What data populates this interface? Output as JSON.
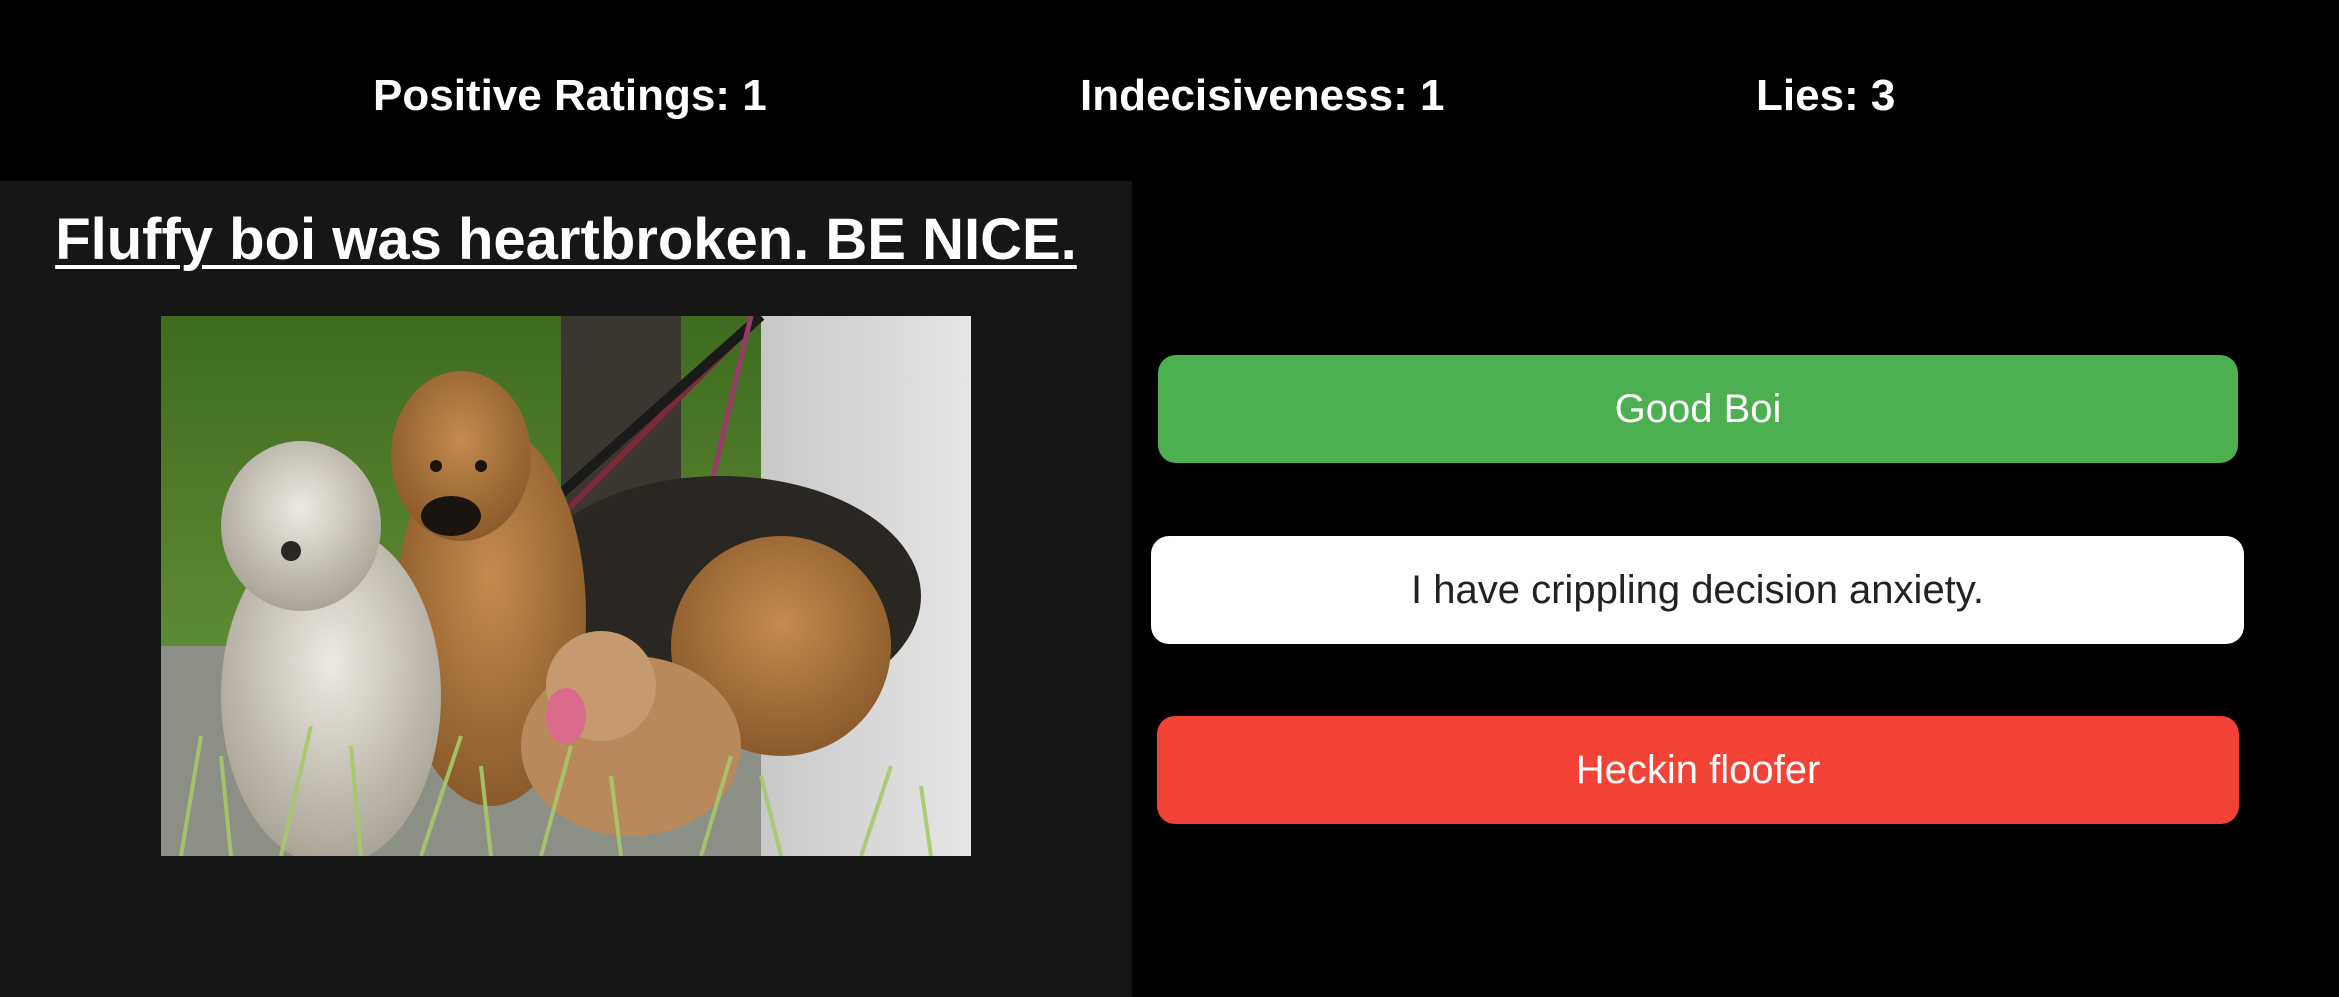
{
  "stats": {
    "positive_ratings": "Positive Ratings: 1",
    "indecisiveness": "Indecisiveness: 1",
    "lies": "Lies: 3"
  },
  "prompt": {
    "title": "Fluffy boi was heartbroken. BE NICE."
  },
  "photo": {
    "subject": "group of shaggy dogs on leashes"
  },
  "choices": {
    "good": {
      "label": "Good Boi",
      "color": "#4caf50"
    },
    "anxiety": {
      "label": "I have crippling decision anxiety.",
      "color": "#ffffff"
    },
    "floofer": {
      "label": "Heckin floofer",
      "color": "#f44336"
    }
  }
}
